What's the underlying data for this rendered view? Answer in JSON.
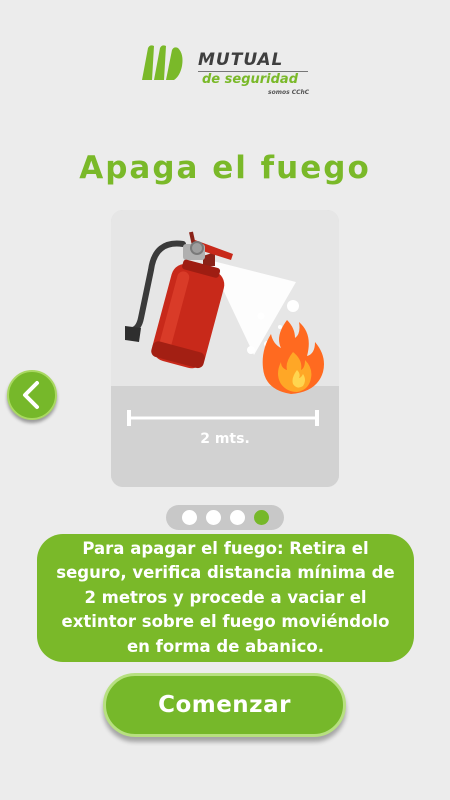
{
  "logo": {
    "brand": "MUTUAL",
    "subtitle": "de seguridad",
    "tagline": "somos CChC"
  },
  "page": {
    "title": "Apaga el fuego"
  },
  "illustration": {
    "distance_label": "2 mts.",
    "icons": [
      "fire-extinguisher-icon",
      "fire-icon"
    ]
  },
  "carousel": {
    "total_steps": 4,
    "active_step": 4
  },
  "instructions": {
    "text": "Para apagar el fuego: Retira el seguro, verifica distancia mínima de 2 metros y procede a vaciar el extintor sobre el fuego moviéndolo en forma de abanico."
  },
  "actions": {
    "prev_icon": "chevron-left-icon",
    "start_label": "Comenzar"
  },
  "colors": {
    "accent": "#7ab929",
    "background": "#ececec",
    "extinguisher": "#c8291a",
    "fire": "#ff6a20"
  }
}
